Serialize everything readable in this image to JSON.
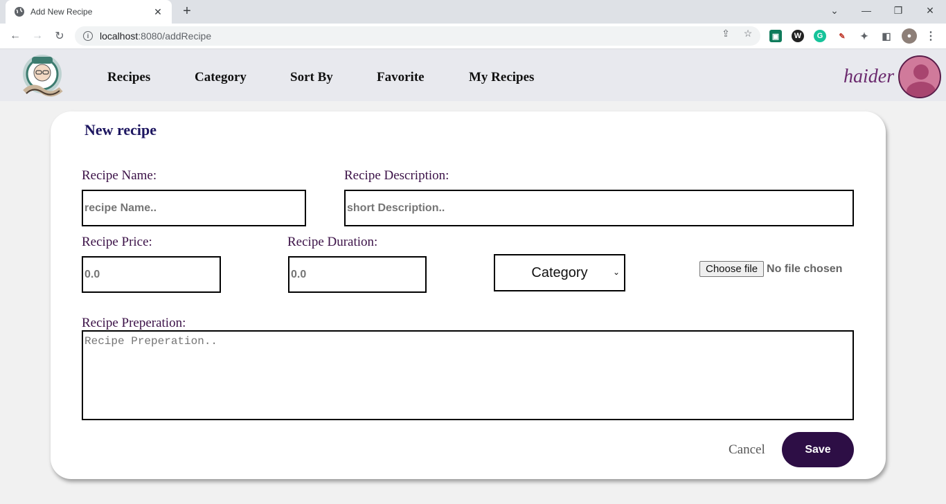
{
  "browser": {
    "tab_title": "Add New Recipe",
    "url_host": "localhost",
    "url_rest": ":8080/addRecipe"
  },
  "nav": {
    "items": [
      {
        "label": "Recipes"
      },
      {
        "label": "Category"
      },
      {
        "label": "Sort By"
      },
      {
        "label": "Favorite"
      },
      {
        "label": "My Recipes"
      }
    ],
    "username": "haider"
  },
  "form": {
    "title": "New recipe",
    "name_label": "Recipe Name:",
    "name_placeholder": "recipe Name..",
    "description_label": "Recipe Description:",
    "description_placeholder": "short Description..",
    "price_label": "Recipe Price:",
    "price_placeholder": "0.0",
    "duration_label": "Recipe Duration:",
    "duration_placeholder": "0.0",
    "category_selected": "Category",
    "file_button": "Choose file",
    "file_status": "No file chosen",
    "preparation_label": "Recipe Preperation:",
    "preparation_placeholder": "Recipe Preperation..",
    "cancel_label": "Cancel",
    "save_label": "Save"
  },
  "colors": {
    "save_button": "#2d0e45",
    "title": "#1d1660",
    "label": "#3b1147",
    "username": "#6b2a6e",
    "avatar": "#d07a9b"
  }
}
